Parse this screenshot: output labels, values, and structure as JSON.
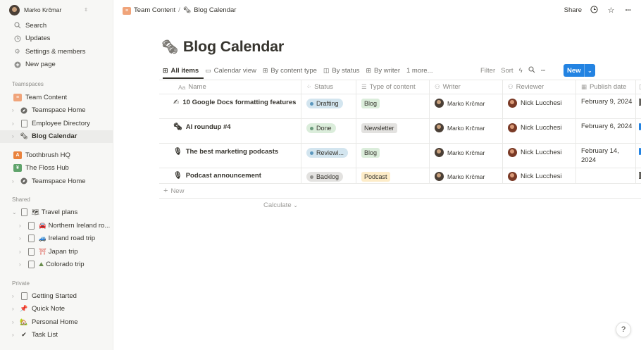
{
  "workspace": {
    "name": "Marko Krčmar",
    "switch_icon": "chevron-updown-icon"
  },
  "sidebar": {
    "top_items": [
      {
        "label": "Search",
        "icon": "search-icon"
      },
      {
        "label": "Updates",
        "icon": "clock-icon"
      },
      {
        "label": "Settings & members",
        "icon": "gear-icon"
      },
      {
        "label": "New page",
        "icon": "plus-circle-icon"
      }
    ],
    "teamspaces_label": "Teamspaces",
    "teamspaces": [
      {
        "label": "Team Content",
        "icon": "team-badge-icon"
      },
      {
        "label": "Teamspace Home",
        "icon": "compass-icon"
      },
      {
        "label": "Employee Directory",
        "icon": "page-icon"
      },
      {
        "label": "Blog Calendar",
        "icon": "newspaper-icon"
      },
      {
        "label": "Toothbrush HQ",
        "icon": "team-badge-icon"
      },
      {
        "label": "The Floss Hub",
        "icon": "team-badge-icon"
      },
      {
        "label": "Teamspace Home",
        "icon": "compass-icon"
      }
    ],
    "shared_label": "Shared",
    "shared": [
      {
        "label": "Travel plans",
        "emoji": "🗺"
      },
      {
        "label": "Northern Ireland ro...",
        "emoji": "🚘"
      },
      {
        "label": "Ireland road trip",
        "emoji": "🚙"
      },
      {
        "label": "Japan trip",
        "emoji": "⛩"
      },
      {
        "label": "Colorado trip",
        "emoji": "⛰"
      }
    ],
    "private_label": "Private",
    "private": [
      {
        "label": "Getting Started",
        "icon": "page-icon"
      },
      {
        "label": "Quick Note",
        "emoji": "📌"
      },
      {
        "label": "Personal Home",
        "emoji": "🏡"
      },
      {
        "label": "Task List",
        "emoji": "✔"
      }
    ]
  },
  "breadcrumb": {
    "parent": "Team Content",
    "separator": "/",
    "current": "Blog Calendar"
  },
  "topbar": {
    "share_label": "Share",
    "icons": [
      "clock-icon",
      "star-icon",
      "more-icon"
    ]
  },
  "page": {
    "title": "Blog Calendar",
    "title_icon": "newspaper-icon"
  },
  "views": [
    {
      "label": "All items",
      "icon": "table-icon",
      "active": true
    },
    {
      "label": "Calendar view",
      "icon": "calendar-icon"
    },
    {
      "label": "By content type",
      "icon": "table-icon"
    },
    {
      "label": "By status",
      "icon": "board-icon"
    },
    {
      "label": "By writer",
      "icon": "table-icon"
    },
    {
      "label": "1 more...",
      "icon": ""
    }
  ],
  "toolbar": {
    "filter_label": "Filter",
    "sort_label": "Sort",
    "new_label": "New",
    "icons": [
      "lightning-icon",
      "search-icon",
      "more-icon"
    ]
  },
  "table": {
    "columns": [
      {
        "label": "Name",
        "icon": "Aa"
      },
      {
        "label": "Status",
        "icon": "status-icon"
      },
      {
        "label": "Type of content",
        "icon": "list-icon"
      },
      {
        "label": "Writer",
        "icon": "people-icon"
      },
      {
        "label": "Reviewer",
        "icon": "people-icon"
      },
      {
        "label": "Publish date",
        "icon": "calendar-icon"
      }
    ],
    "rows": [
      {
        "name": "10 Google Docs formatting features",
        "emoji": "✍",
        "status": "Drafting",
        "type": "Blog",
        "writer": "Marko Krčmar",
        "reviewer": "Nick Lucchesi",
        "date": "February 9, 2024"
      },
      {
        "name": "AI roundup #4",
        "emoji": "🗞",
        "status": "Done",
        "type": "Newsletter",
        "writer": "Marko Krčmar",
        "reviewer": "Nick Lucchesi",
        "date": "February 6, 2024"
      },
      {
        "name": "The best marketing podcasts",
        "emoji": "🎙",
        "status": "Reviewi...",
        "type": "Blog",
        "writer": "Marko Krčmar",
        "reviewer": "Nick Lucchesi",
        "date": "February 14, 2024"
      },
      {
        "name": "Podcast announcement",
        "emoji": "🎙",
        "status": "Backlog",
        "type": "Podcast",
        "writer": "Marko Krčmar",
        "reviewer": "Nick Lucchesi",
        "date": ""
      }
    ],
    "new_row_label": "New",
    "calculate_label": "Calculate"
  },
  "colors": {
    "accent": "#2383e2",
    "status_drafting_bg": "#d3e5ef",
    "status_drafting_dot": "#5b97bd",
    "status_done_bg": "#dbeddb",
    "status_done_dot": "#6c9b7d",
    "status_review_bg": "#d3e5ef",
    "status_review_dot": "#5b97bd",
    "status_backlog_bg": "#e3e2e0",
    "status_backlog_dot": "#91918e",
    "tag_blog_bg": "#dbeddb",
    "tag_newsletter_bg": "#e3e2e0",
    "tag_podcast_bg": "#fdecc8"
  },
  "help": {
    "label": "?"
  }
}
